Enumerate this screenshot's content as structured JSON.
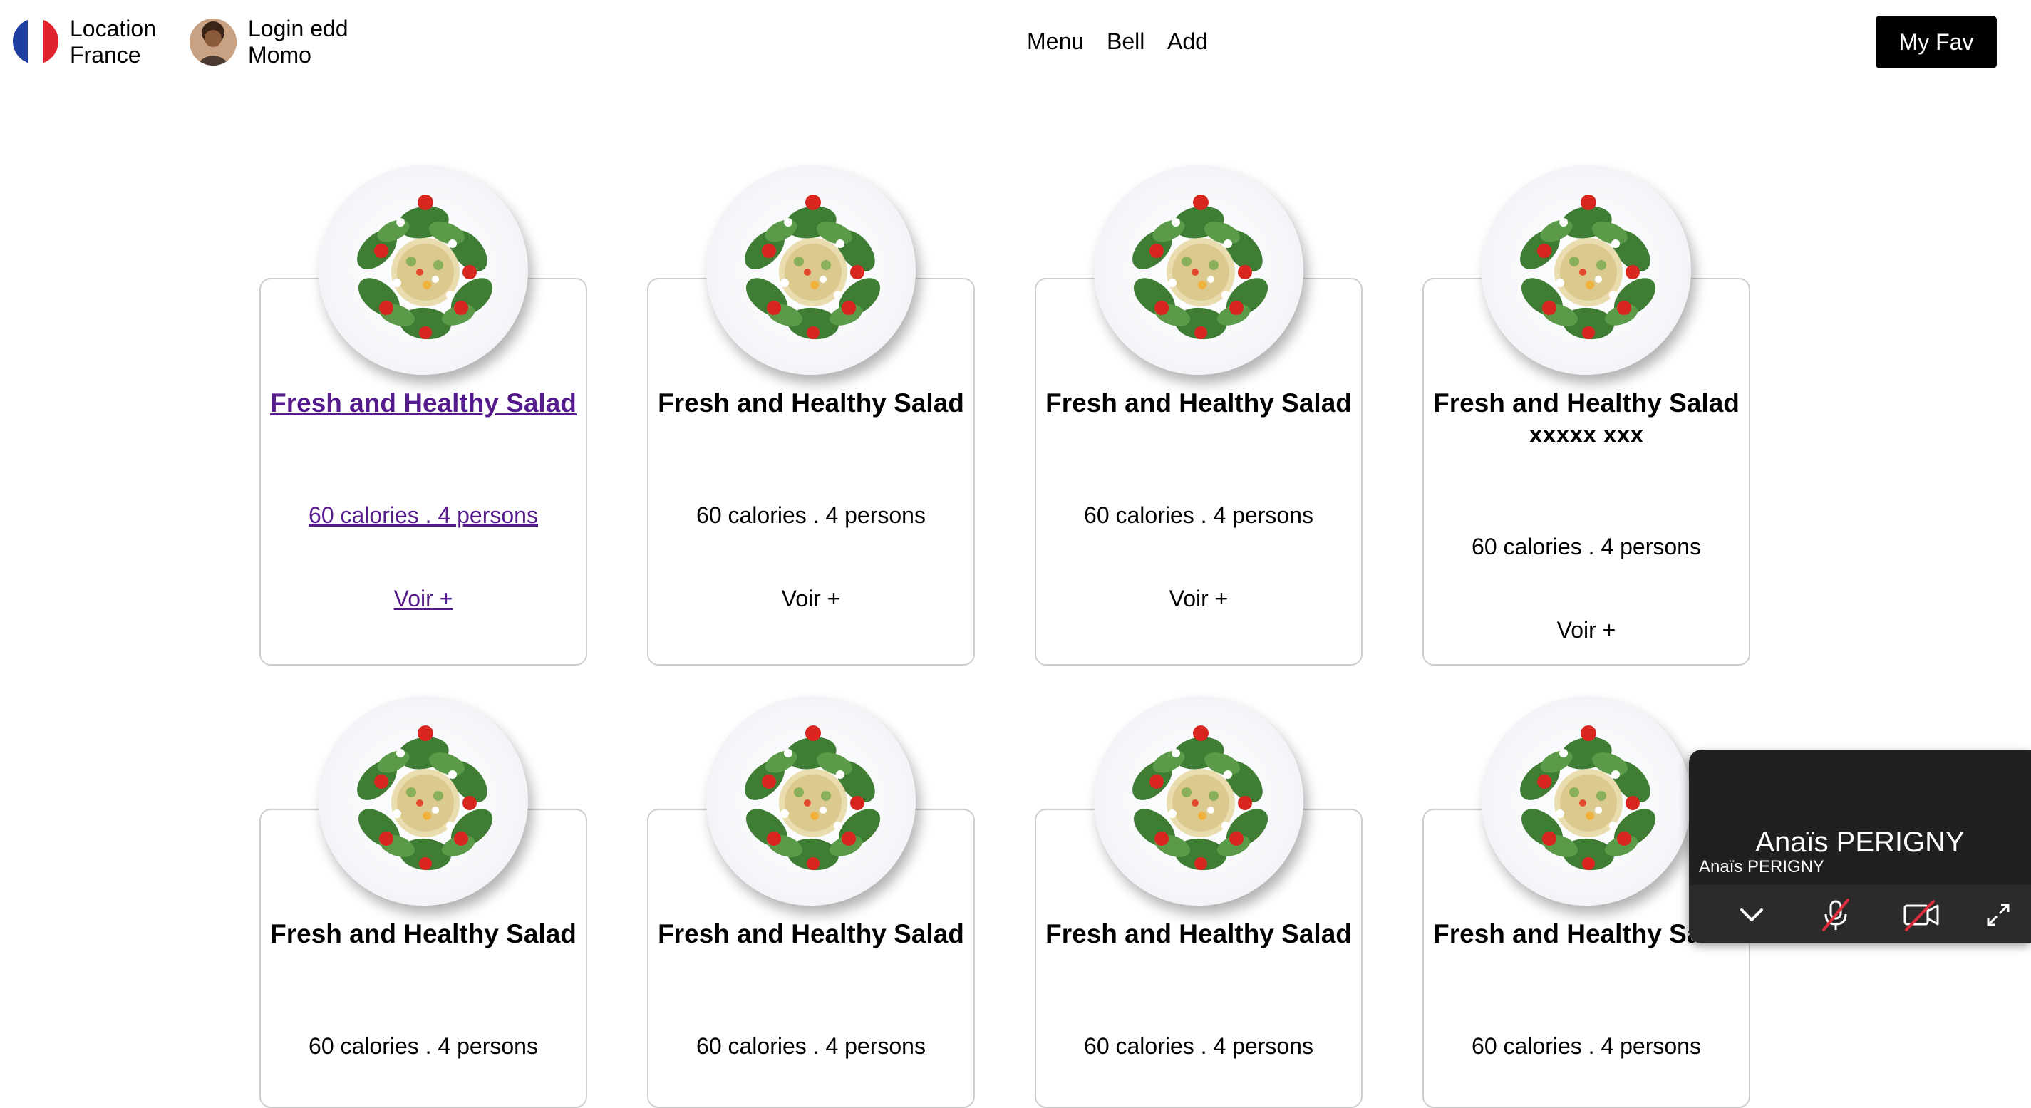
{
  "header": {
    "location_label": "Location",
    "location_value": "France",
    "login_label": "Login edd",
    "user_name": "Momo",
    "nav": [
      "Menu",
      "Bell",
      "Add"
    ],
    "fav_button": "My Fav"
  },
  "cards": [
    {
      "title": "Fresh and Healthy Salad",
      "subtitle": "",
      "meta": "60 calories . 4 persons",
      "voir": "Voir +"
    },
    {
      "title": "Fresh and Healthy Salad",
      "subtitle": "",
      "meta": "60 calories . 4 persons",
      "voir": "Voir +"
    },
    {
      "title": "Fresh and Healthy Salad",
      "subtitle": "",
      "meta": "60 calories . 4 persons",
      "voir": "Voir +"
    },
    {
      "title": "Fresh and Healthy Salad",
      "subtitle": "xxxxx xxx",
      "meta": "60 calories . 4 persons",
      "voir": "Voir +"
    },
    {
      "title": "Fresh and Healthy Salad",
      "subtitle": "",
      "meta": "60 calories . 4 persons",
      "voir": ""
    },
    {
      "title": "Fresh and Healthy Salad",
      "subtitle": "",
      "meta": "60 calories . 4 persons",
      "voir": ""
    },
    {
      "title": "Fresh and Healthy Salad",
      "subtitle": "",
      "meta": "60 calories . 4 persons",
      "voir": ""
    },
    {
      "title": "Fresh and Healthy Salad",
      "subtitle": "",
      "meta": "60 calories . 4 persons",
      "voir": ""
    }
  ],
  "call": {
    "participant_big": "Anaïs PERIGNY",
    "participant_small": "Anaïs PERIGNY"
  },
  "colors": {
    "visited_link": "#551a8b",
    "flag_blue": "#1f3fa0",
    "flag_red": "#e0242d",
    "muted_red": "#e02b3a"
  },
  "icons": [
    "france-flag-icon",
    "avatar",
    "salad-plate-image",
    "chevron-down-icon",
    "mic-off-icon",
    "camera-off-icon",
    "fullscreen-icon"
  ]
}
